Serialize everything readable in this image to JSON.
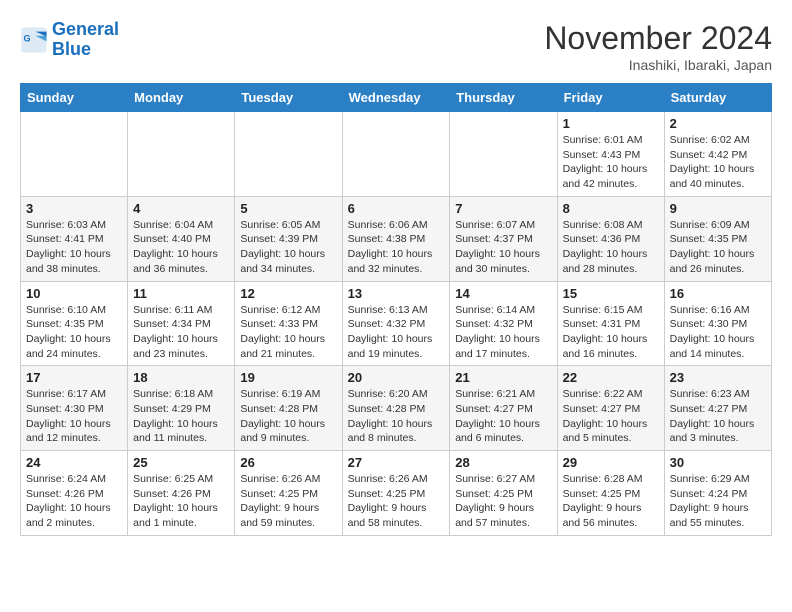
{
  "logo": {
    "line1": "General",
    "line2": "Blue"
  },
  "title": "November 2024",
  "subtitle": "Inashiki, Ibaraki, Japan",
  "header": {
    "days": [
      "Sunday",
      "Monday",
      "Tuesday",
      "Wednesday",
      "Thursday",
      "Friday",
      "Saturday"
    ]
  },
  "weeks": [
    [
      {
        "day": "",
        "info": ""
      },
      {
        "day": "",
        "info": ""
      },
      {
        "day": "",
        "info": ""
      },
      {
        "day": "",
        "info": ""
      },
      {
        "day": "",
        "info": ""
      },
      {
        "day": "1",
        "info": "Sunrise: 6:01 AM\nSunset: 4:43 PM\nDaylight: 10 hours and 42 minutes."
      },
      {
        "day": "2",
        "info": "Sunrise: 6:02 AM\nSunset: 4:42 PM\nDaylight: 10 hours and 40 minutes."
      }
    ],
    [
      {
        "day": "3",
        "info": "Sunrise: 6:03 AM\nSunset: 4:41 PM\nDaylight: 10 hours and 38 minutes."
      },
      {
        "day": "4",
        "info": "Sunrise: 6:04 AM\nSunset: 4:40 PM\nDaylight: 10 hours and 36 minutes."
      },
      {
        "day": "5",
        "info": "Sunrise: 6:05 AM\nSunset: 4:39 PM\nDaylight: 10 hours and 34 minutes."
      },
      {
        "day": "6",
        "info": "Sunrise: 6:06 AM\nSunset: 4:38 PM\nDaylight: 10 hours and 32 minutes."
      },
      {
        "day": "7",
        "info": "Sunrise: 6:07 AM\nSunset: 4:37 PM\nDaylight: 10 hours and 30 minutes."
      },
      {
        "day": "8",
        "info": "Sunrise: 6:08 AM\nSunset: 4:36 PM\nDaylight: 10 hours and 28 minutes."
      },
      {
        "day": "9",
        "info": "Sunrise: 6:09 AM\nSunset: 4:35 PM\nDaylight: 10 hours and 26 minutes."
      }
    ],
    [
      {
        "day": "10",
        "info": "Sunrise: 6:10 AM\nSunset: 4:35 PM\nDaylight: 10 hours and 24 minutes."
      },
      {
        "day": "11",
        "info": "Sunrise: 6:11 AM\nSunset: 4:34 PM\nDaylight: 10 hours and 23 minutes."
      },
      {
        "day": "12",
        "info": "Sunrise: 6:12 AM\nSunset: 4:33 PM\nDaylight: 10 hours and 21 minutes."
      },
      {
        "day": "13",
        "info": "Sunrise: 6:13 AM\nSunset: 4:32 PM\nDaylight: 10 hours and 19 minutes."
      },
      {
        "day": "14",
        "info": "Sunrise: 6:14 AM\nSunset: 4:32 PM\nDaylight: 10 hours and 17 minutes."
      },
      {
        "day": "15",
        "info": "Sunrise: 6:15 AM\nSunset: 4:31 PM\nDaylight: 10 hours and 16 minutes."
      },
      {
        "day": "16",
        "info": "Sunrise: 6:16 AM\nSunset: 4:30 PM\nDaylight: 10 hours and 14 minutes."
      }
    ],
    [
      {
        "day": "17",
        "info": "Sunrise: 6:17 AM\nSunset: 4:30 PM\nDaylight: 10 hours and 12 minutes."
      },
      {
        "day": "18",
        "info": "Sunrise: 6:18 AM\nSunset: 4:29 PM\nDaylight: 10 hours and 11 minutes."
      },
      {
        "day": "19",
        "info": "Sunrise: 6:19 AM\nSunset: 4:28 PM\nDaylight: 10 hours and 9 minutes."
      },
      {
        "day": "20",
        "info": "Sunrise: 6:20 AM\nSunset: 4:28 PM\nDaylight: 10 hours and 8 minutes."
      },
      {
        "day": "21",
        "info": "Sunrise: 6:21 AM\nSunset: 4:27 PM\nDaylight: 10 hours and 6 minutes."
      },
      {
        "day": "22",
        "info": "Sunrise: 6:22 AM\nSunset: 4:27 PM\nDaylight: 10 hours and 5 minutes."
      },
      {
        "day": "23",
        "info": "Sunrise: 6:23 AM\nSunset: 4:27 PM\nDaylight: 10 hours and 3 minutes."
      }
    ],
    [
      {
        "day": "24",
        "info": "Sunrise: 6:24 AM\nSunset: 4:26 PM\nDaylight: 10 hours and 2 minutes."
      },
      {
        "day": "25",
        "info": "Sunrise: 6:25 AM\nSunset: 4:26 PM\nDaylight: 10 hours and 1 minute."
      },
      {
        "day": "26",
        "info": "Sunrise: 6:26 AM\nSunset: 4:25 PM\nDaylight: 9 hours and 59 minutes."
      },
      {
        "day": "27",
        "info": "Sunrise: 6:26 AM\nSunset: 4:25 PM\nDaylight: 9 hours and 58 minutes."
      },
      {
        "day": "28",
        "info": "Sunrise: 6:27 AM\nSunset: 4:25 PM\nDaylight: 9 hours and 57 minutes."
      },
      {
        "day": "29",
        "info": "Sunrise: 6:28 AM\nSunset: 4:25 PM\nDaylight: 9 hours and 56 minutes."
      },
      {
        "day": "30",
        "info": "Sunrise: 6:29 AM\nSunset: 4:24 PM\nDaylight: 9 hours and 55 minutes."
      }
    ]
  ]
}
